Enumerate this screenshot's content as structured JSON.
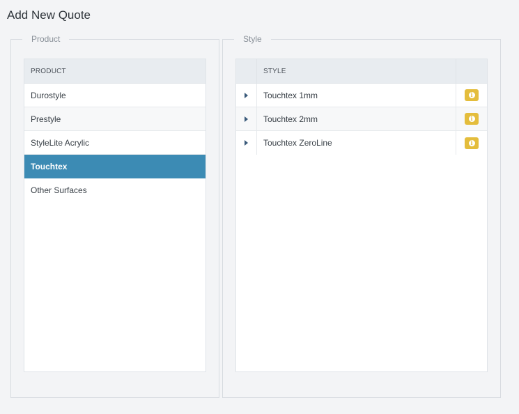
{
  "page": {
    "title": "Add New Quote"
  },
  "product_group": {
    "legend": "Product",
    "column_header": "PRODUCT",
    "items": [
      {
        "label": "Durostyle",
        "selected": false
      },
      {
        "label": "Prestyle",
        "selected": false
      },
      {
        "label": "StyleLite Acrylic",
        "selected": false
      },
      {
        "label": "Touchtex",
        "selected": true
      },
      {
        "label": "Other Surfaces",
        "selected": false
      }
    ]
  },
  "style_group": {
    "legend": "Style",
    "column_header": "STYLE",
    "items": [
      {
        "label": "Touchtex 1mm",
        "expand_icon": "caret-right-icon",
        "info_icon": "info-icon"
      },
      {
        "label": "Touchtex 2mm",
        "expand_icon": "caret-right-icon",
        "info_icon": "info-icon"
      },
      {
        "label": "Touchtex ZeroLine",
        "expand_icon": "caret-right-icon",
        "info_icon": "info-icon"
      }
    ]
  },
  "colors": {
    "selected_row": "#3c8bb4",
    "info_button": "#e4bd3c",
    "header_bg": "#e8ecf0",
    "page_bg": "#f3f4f6"
  }
}
